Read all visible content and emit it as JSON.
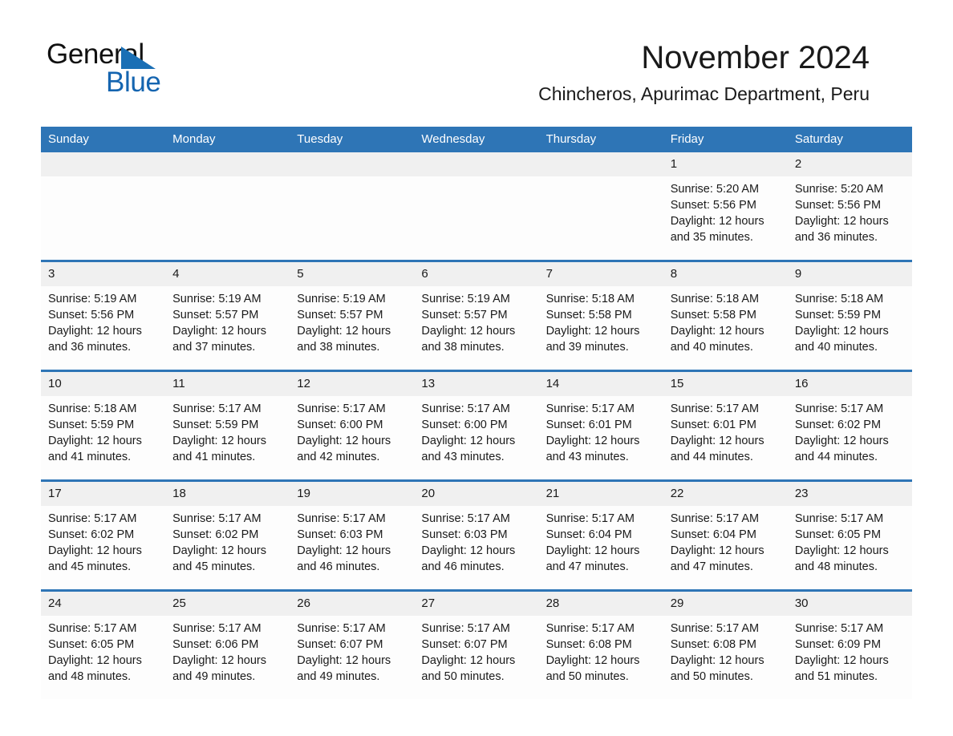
{
  "brand": {
    "line1": "General",
    "line2": "Blue",
    "triangle_color": "#1a6fb5",
    "text_color": "#111111",
    "blue_text_color": "#1565b0"
  },
  "header": {
    "month_title": "November 2024",
    "location": "Chincheros, Apurimac Department, Peru"
  },
  "theme": {
    "header_blue": "#2e75b6",
    "daynum_band": "#f0f0f0",
    "cell_bg": "#fdfdfd",
    "text": "#1a1a1a"
  },
  "weekday_headers": [
    "Sunday",
    "Monday",
    "Tuesday",
    "Wednesday",
    "Thursday",
    "Friday",
    "Saturday"
  ],
  "weeks": [
    [
      {
        "day": "",
        "lines": []
      },
      {
        "day": "",
        "lines": []
      },
      {
        "day": "",
        "lines": []
      },
      {
        "day": "",
        "lines": []
      },
      {
        "day": "",
        "lines": []
      },
      {
        "day": "1",
        "lines": [
          "Sunrise: 5:20 AM",
          "Sunset: 5:56 PM",
          "Daylight: 12 hours",
          "and 35 minutes."
        ]
      },
      {
        "day": "2",
        "lines": [
          "Sunrise: 5:20 AM",
          "Sunset: 5:56 PM",
          "Daylight: 12 hours",
          "and 36 minutes."
        ]
      }
    ],
    [
      {
        "day": "3",
        "lines": [
          "Sunrise: 5:19 AM",
          "Sunset: 5:56 PM",
          "Daylight: 12 hours",
          "and 36 minutes."
        ]
      },
      {
        "day": "4",
        "lines": [
          "Sunrise: 5:19 AM",
          "Sunset: 5:57 PM",
          "Daylight: 12 hours",
          "and 37 minutes."
        ]
      },
      {
        "day": "5",
        "lines": [
          "Sunrise: 5:19 AM",
          "Sunset: 5:57 PM",
          "Daylight: 12 hours",
          "and 38 minutes."
        ]
      },
      {
        "day": "6",
        "lines": [
          "Sunrise: 5:19 AM",
          "Sunset: 5:57 PM",
          "Daylight: 12 hours",
          "and 38 minutes."
        ]
      },
      {
        "day": "7",
        "lines": [
          "Sunrise: 5:18 AM",
          "Sunset: 5:58 PM",
          "Daylight: 12 hours",
          "and 39 minutes."
        ]
      },
      {
        "day": "8",
        "lines": [
          "Sunrise: 5:18 AM",
          "Sunset: 5:58 PM",
          "Daylight: 12 hours",
          "and 40 minutes."
        ]
      },
      {
        "day": "9",
        "lines": [
          "Sunrise: 5:18 AM",
          "Sunset: 5:59 PM",
          "Daylight: 12 hours",
          "and 40 minutes."
        ]
      }
    ],
    [
      {
        "day": "10",
        "lines": [
          "Sunrise: 5:18 AM",
          "Sunset: 5:59 PM",
          "Daylight: 12 hours",
          "and 41 minutes."
        ]
      },
      {
        "day": "11",
        "lines": [
          "Sunrise: 5:17 AM",
          "Sunset: 5:59 PM",
          "Daylight: 12 hours",
          "and 41 minutes."
        ]
      },
      {
        "day": "12",
        "lines": [
          "Sunrise: 5:17 AM",
          "Sunset: 6:00 PM",
          "Daylight: 12 hours",
          "and 42 minutes."
        ]
      },
      {
        "day": "13",
        "lines": [
          "Sunrise: 5:17 AM",
          "Sunset: 6:00 PM",
          "Daylight: 12 hours",
          "and 43 minutes."
        ]
      },
      {
        "day": "14",
        "lines": [
          "Sunrise: 5:17 AM",
          "Sunset: 6:01 PM",
          "Daylight: 12 hours",
          "and 43 minutes."
        ]
      },
      {
        "day": "15",
        "lines": [
          "Sunrise: 5:17 AM",
          "Sunset: 6:01 PM",
          "Daylight: 12 hours",
          "and 44 minutes."
        ]
      },
      {
        "day": "16",
        "lines": [
          "Sunrise: 5:17 AM",
          "Sunset: 6:02 PM",
          "Daylight: 12 hours",
          "and 44 minutes."
        ]
      }
    ],
    [
      {
        "day": "17",
        "lines": [
          "Sunrise: 5:17 AM",
          "Sunset: 6:02 PM",
          "Daylight: 12 hours",
          "and 45 minutes."
        ]
      },
      {
        "day": "18",
        "lines": [
          "Sunrise: 5:17 AM",
          "Sunset: 6:02 PM",
          "Daylight: 12 hours",
          "and 45 minutes."
        ]
      },
      {
        "day": "19",
        "lines": [
          "Sunrise: 5:17 AM",
          "Sunset: 6:03 PM",
          "Daylight: 12 hours",
          "and 46 minutes."
        ]
      },
      {
        "day": "20",
        "lines": [
          "Sunrise: 5:17 AM",
          "Sunset: 6:03 PM",
          "Daylight: 12 hours",
          "and 46 minutes."
        ]
      },
      {
        "day": "21",
        "lines": [
          "Sunrise: 5:17 AM",
          "Sunset: 6:04 PM",
          "Daylight: 12 hours",
          "and 47 minutes."
        ]
      },
      {
        "day": "22",
        "lines": [
          "Sunrise: 5:17 AM",
          "Sunset: 6:04 PM",
          "Daylight: 12 hours",
          "and 47 minutes."
        ]
      },
      {
        "day": "23",
        "lines": [
          "Sunrise: 5:17 AM",
          "Sunset: 6:05 PM",
          "Daylight: 12 hours",
          "and 48 minutes."
        ]
      }
    ],
    [
      {
        "day": "24",
        "lines": [
          "Sunrise: 5:17 AM",
          "Sunset: 6:05 PM",
          "Daylight: 12 hours",
          "and 48 minutes."
        ]
      },
      {
        "day": "25",
        "lines": [
          "Sunrise: 5:17 AM",
          "Sunset: 6:06 PM",
          "Daylight: 12 hours",
          "and 49 minutes."
        ]
      },
      {
        "day": "26",
        "lines": [
          "Sunrise: 5:17 AM",
          "Sunset: 6:07 PM",
          "Daylight: 12 hours",
          "and 49 minutes."
        ]
      },
      {
        "day": "27",
        "lines": [
          "Sunrise: 5:17 AM",
          "Sunset: 6:07 PM",
          "Daylight: 12 hours",
          "and 50 minutes."
        ]
      },
      {
        "day": "28",
        "lines": [
          "Sunrise: 5:17 AM",
          "Sunset: 6:08 PM",
          "Daylight: 12 hours",
          "and 50 minutes."
        ]
      },
      {
        "day": "29",
        "lines": [
          "Sunrise: 5:17 AM",
          "Sunset: 6:08 PM",
          "Daylight: 12 hours",
          "and 50 minutes."
        ]
      },
      {
        "day": "30",
        "lines": [
          "Sunrise: 5:17 AM",
          "Sunset: 6:09 PM",
          "Daylight: 12 hours",
          "and 51 minutes."
        ]
      }
    ]
  ]
}
